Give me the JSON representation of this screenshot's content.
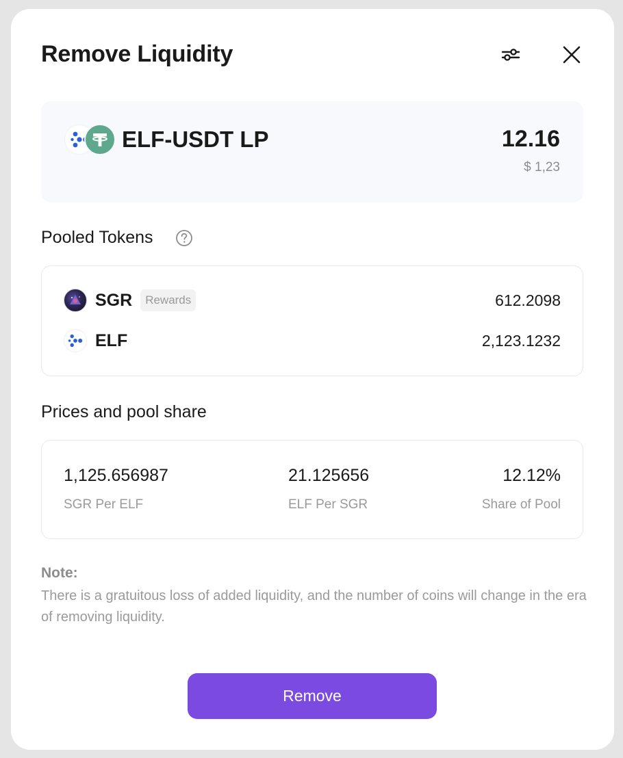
{
  "modal": {
    "title": "Remove Liquidity",
    "settings_icon": "sliders-icon",
    "close_icon": "close-icon"
  },
  "lp": {
    "name": "ELF-USDT LP",
    "amount": "12.16",
    "usd_value": "$ 1,23",
    "logos": [
      "elf-logo-icon",
      "usdt-logo-icon"
    ],
    "usdt_color": "#5ea88e"
  },
  "pooled": {
    "title": "Pooled Tokens",
    "help_icon": "question-circle-icon",
    "tokens": [
      {
        "symbol": "SGR",
        "badge": "Rewards",
        "amount": "612.2098"
      },
      {
        "symbol": "ELF",
        "badge": "",
        "amount": "2,123.1232"
      }
    ]
  },
  "prices": {
    "title": "Prices and pool share",
    "items": [
      {
        "value": "1,125.656987",
        "label": "SGR Per ELF"
      },
      {
        "value": "21.125656",
        "label": "ELF Per SGR"
      },
      {
        "value": "12.12%",
        "label": "Share of Pool"
      }
    ]
  },
  "note": {
    "title": "Note:",
    "text": "There is a gratuitous loss of added liquidity, and the number of coins will change in the era of removing liquidity."
  },
  "actions": {
    "remove_label": "Remove",
    "accent_color": "#7b4ae0"
  }
}
